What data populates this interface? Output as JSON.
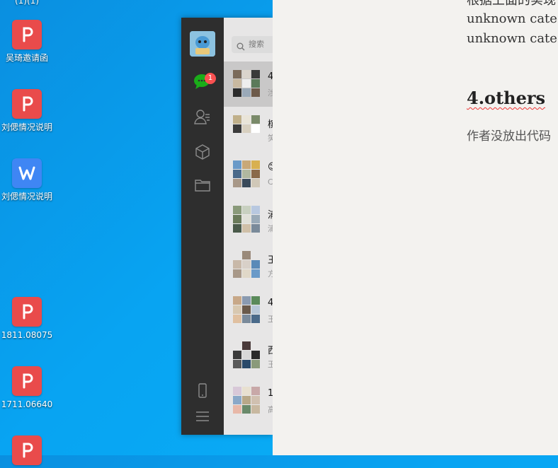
{
  "desktop": {
    "top_fragment": "(1)(1)",
    "icons": [
      {
        "type": "pdf",
        "label": "吴琦邀请函"
      },
      {
        "type": "pdf",
        "label": "刘偲情况说明"
      },
      {
        "type": "wps",
        "label": "刘偲情况说明"
      },
      {
        "type": "pdf",
        "label": "1811.08075"
      },
      {
        "type": "pdf",
        "label": "1711.06640"
      },
      {
        "type": "pdf",
        "label": ""
      }
    ]
  },
  "chat_app": {
    "search_placeholder": "搜索",
    "unread_badge": "1",
    "nav": [
      "chat-icon",
      "contacts-icon",
      "box-icon",
      "folder-icon",
      "phone-icon",
      "menu-icon"
    ],
    "conversations": [
      {
        "title": "4",
        "subtitle": "涉",
        "active": true
      },
      {
        "title": "槟",
        "subtitle": "笑"
      },
      {
        "title": "😊",
        "subtitle": "C"
      },
      {
        "title": "浦",
        "subtitle": "浦"
      },
      {
        "title": "王",
        "subtitle": "方"
      },
      {
        "title": "4",
        "subtitle": "王"
      },
      {
        "title": "西",
        "subtitle": "王"
      },
      {
        "title": "1",
        "subtitle": "高"
      }
    ]
  },
  "document": {
    "lines": [
      "根据上面的实现",
      "unknown categ",
      "unknown categ"
    ],
    "heading": "4.others",
    "paragraph": "作者没放出代码"
  },
  "colors": {
    "desktop_bg": "#0aa0f0",
    "nav_bg": "#2e2e2e",
    "accent_green": "#1aad19",
    "badge_red": "#fa5151"
  }
}
